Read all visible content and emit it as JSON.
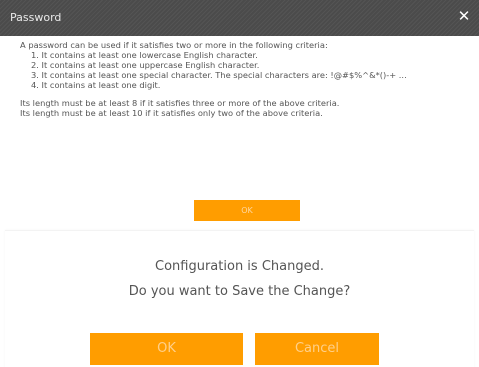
{
  "password_dialog": {
    "title": "Password",
    "close_symbol": "✕",
    "intro": "A password can be used if it satisfies two or more in the following criteria:",
    "criteria": [
      "1. It contains at least one lowercase English character.",
      "2. It contains at least one uppercase English character.",
      "3. It contains at least one special character. The special characters are: !@#$%^&*()-+ ...",
      "4. It contains at least one digit."
    ],
    "length_rules": [
      "Its length must be at least 8 if it satisfies three or more of the above criteria.",
      "Its length must be at least 10 if it satisfies only two of the above criteria."
    ],
    "ok_label": "OK"
  },
  "save_dialog": {
    "message_line1": "Configuration is Changed.",
    "message_line2": "Do you want to Save the Change?",
    "ok_label": "OK",
    "cancel_label": "Cancel"
  },
  "colors": {
    "titlebar": "#4b4b4b",
    "accent_orange": "#ff9d00",
    "text_gray": "#555555"
  },
  "icons": {
    "close": "close-icon"
  }
}
